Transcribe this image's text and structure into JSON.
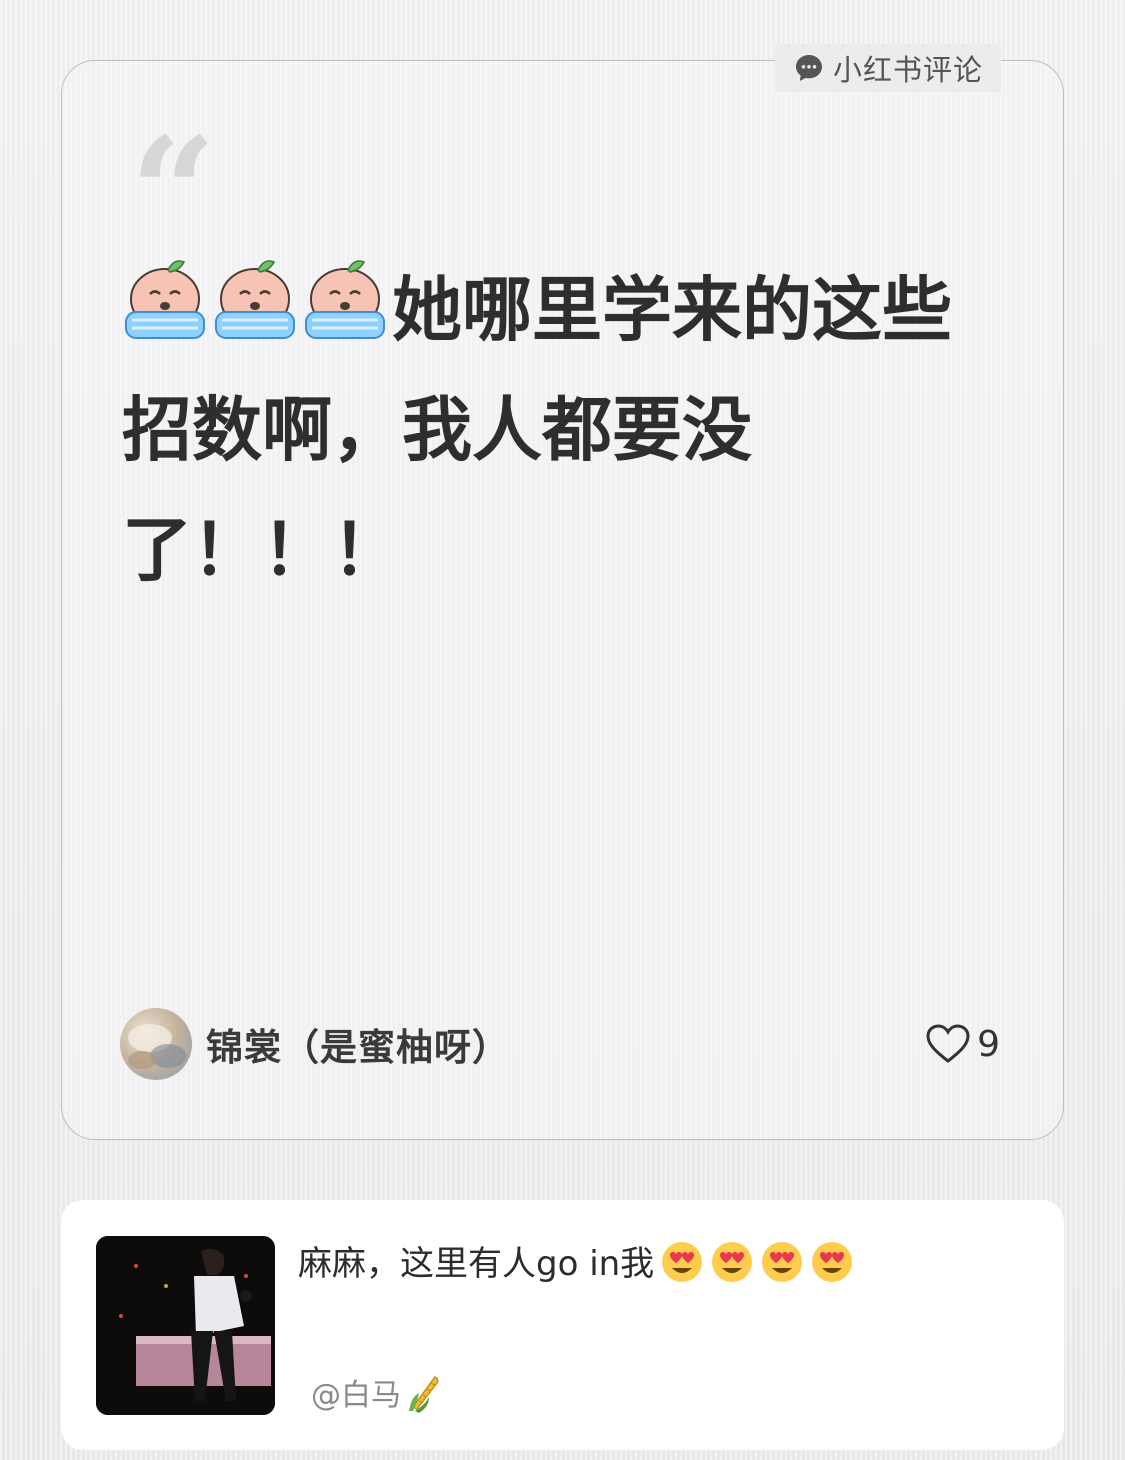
{
  "tag": {
    "label": "小红书评论",
    "icon": "chat-bubble-icon"
  },
  "comment": {
    "line1": "她哪里学来的这些",
    "line2": "招数啊，我人都要没",
    "line3": "了！！！",
    "stickers": [
      "crying-sticker-icon",
      "crying-sticker-icon",
      "crying-sticker-icon"
    ]
  },
  "author": {
    "name": "锦裳（是蜜柚呀）",
    "like_count": "9",
    "like_icon": "heart-outline-icon"
  },
  "reference": {
    "text": "麻麻，这里有人go in我",
    "emojis": [
      "heart-eyes-emoji",
      "heart-eyes-emoji",
      "heart-eyes-emoji",
      "heart-eyes-emoji"
    ],
    "author": "@白马",
    "author_icon": "corn-icon"
  },
  "colors": {
    "background": "#ececee",
    "text": "#2e2e2e",
    "muted": "#8a8a8a"
  }
}
